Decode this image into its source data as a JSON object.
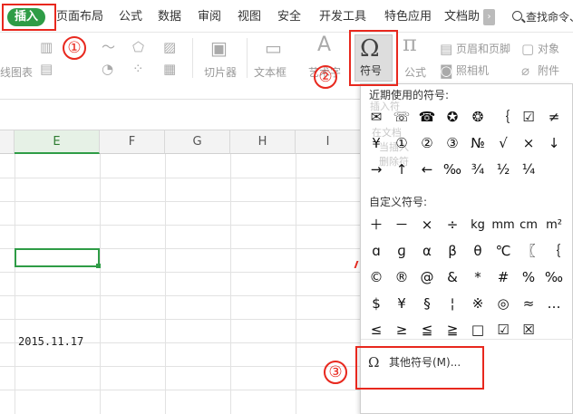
{
  "menubar": {
    "tabs": [
      {
        "label": "插入",
        "active": true
      },
      {
        "label": "页面布局"
      },
      {
        "label": "公式"
      },
      {
        "label": "数据"
      },
      {
        "label": "审阅"
      },
      {
        "label": "视图"
      },
      {
        "label": "安全"
      },
      {
        "label": "开发工具"
      },
      {
        "label": "特色应用"
      },
      {
        "label": "文档助"
      }
    ],
    "more_glyph": "›",
    "search_label": "查找命令、"
  },
  "toolbar": {
    "chart_label": "线图表",
    "slicer_label": "切片器",
    "textbox_label": "文本框",
    "art_label": "艺术字",
    "symbol_label": "符号",
    "symbol_glyph": "Ω",
    "formula_label": "公式",
    "formula_glyph": "π",
    "header_footer_label": "页眉和页脚",
    "object_label": "对象",
    "camera_label": "照相机",
    "attachment_label": "附件"
  },
  "sheet": {
    "columns": [
      "E",
      "F",
      "G",
      "H",
      "I"
    ],
    "active_column": "E",
    "date_cell": "2015.11.17"
  },
  "symbol_panel": {
    "recent_title": "近期使用的符号:",
    "recent_symbols": [
      "✉",
      "☏",
      "☎",
      "✪",
      "❂",
      "｛",
      "☑",
      "≠",
      "¥",
      "①",
      "②",
      "③",
      "№",
      "√",
      "×",
      "↓",
      "→",
      "↑",
      "←",
      "‰",
      "¾",
      "½",
      "¼"
    ],
    "custom_title": "自定义符号:",
    "custom_symbols": [
      "＋",
      "－",
      "×",
      "÷",
      "kg",
      "mm",
      "cm",
      "m²",
      "ɑ",
      "ɡ",
      "α",
      "β",
      "θ",
      "℃",
      "〖",
      "｛",
      "©",
      "®",
      "@",
      "&",
      "*",
      "#",
      "%",
      "‰",
      "$",
      "¥",
      "§",
      "¦",
      "※",
      "◎",
      "≈",
      "…",
      "≤",
      "≥",
      "≦",
      "≧",
      "□",
      "☑",
      "☒"
    ],
    "ghost_texts": [
      "插入符",
      "在文档",
      "当插入",
      "删除符"
    ],
    "more_label": "其他符号(M)...",
    "more_glyph": "Ω"
  },
  "annotations": {
    "step1": "①",
    "step2": "②",
    "step3": "③",
    "color": "#e8281e"
  }
}
